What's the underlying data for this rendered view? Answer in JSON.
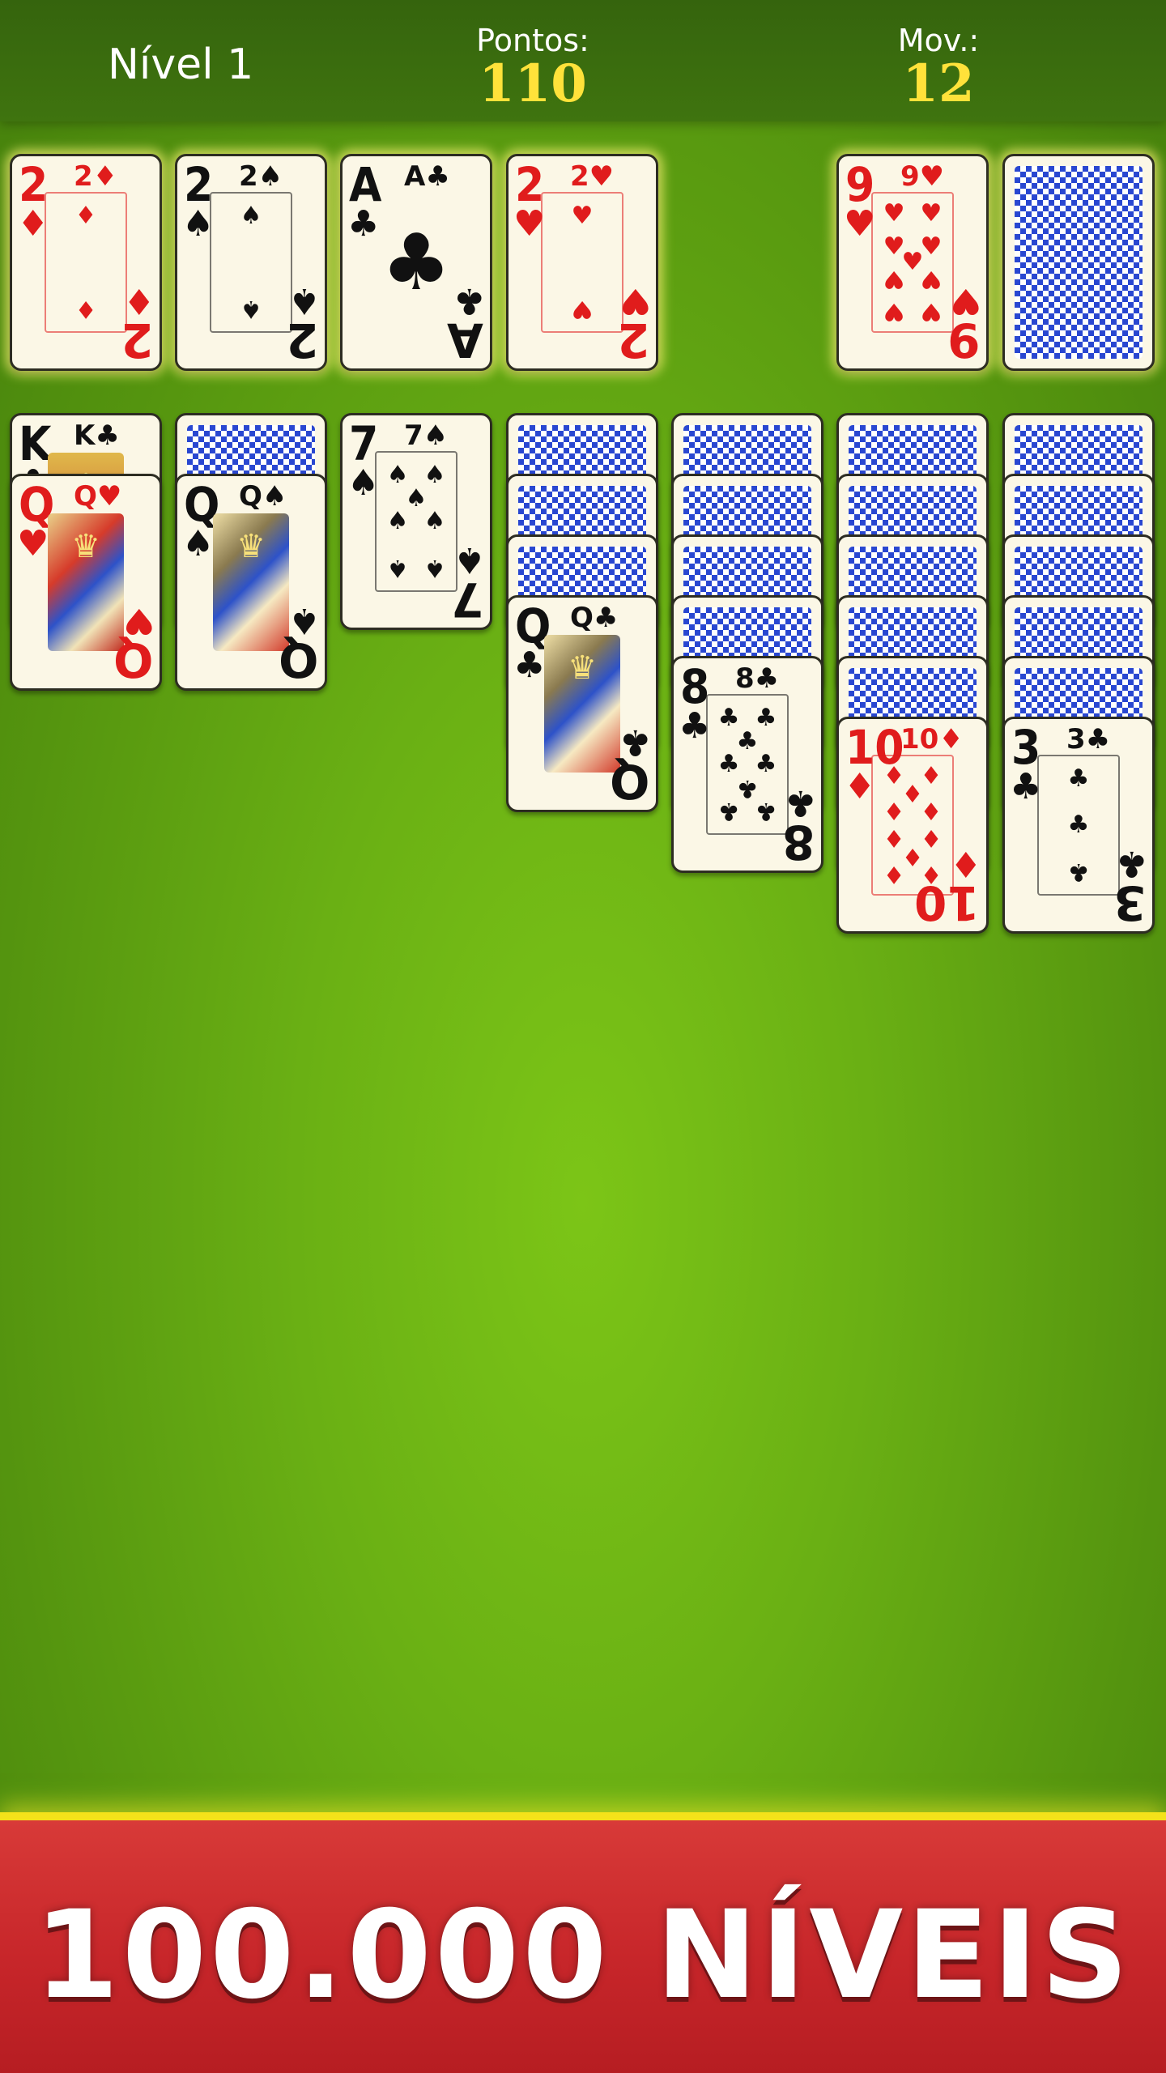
{
  "header": {
    "level": "Nível 1",
    "points_label": "Pontos:",
    "points_value": "110",
    "moves_label": "Mov.:",
    "moves_value": "12"
  },
  "foundations": [
    {
      "rank": "2",
      "suit": "♦",
      "color": "red"
    },
    {
      "rank": "2",
      "suit": "♠",
      "color": "black"
    },
    {
      "rank": "A",
      "suit": "♣",
      "color": "black"
    },
    {
      "rank": "2",
      "suit": "♥",
      "color": "red"
    }
  ],
  "waste": {
    "rank": "9",
    "suit": "♥",
    "color": "red"
  },
  "stock": {
    "face_down": true
  },
  "tableau": [
    {
      "down": 0,
      "up": [
        {
          "rank": "K",
          "suit": "♣",
          "color": "black"
        },
        {
          "rank": "Q",
          "suit": "♥",
          "color": "red"
        }
      ]
    },
    {
      "down": 1,
      "up": [
        {
          "rank": "Q",
          "suit": "♠",
          "color": "black"
        }
      ]
    },
    {
      "down": 0,
      "up": [
        {
          "rank": "7",
          "suit": "♠",
          "color": "black"
        }
      ]
    },
    {
      "down": 3,
      "up": [
        {
          "rank": "Q",
          "suit": "♣",
          "color": "black"
        }
      ]
    },
    {
      "down": 4,
      "up": [
        {
          "rank": "8",
          "suit": "♣",
          "color": "black"
        }
      ]
    },
    {
      "down": 5,
      "up": [
        {
          "rank": "10",
          "suit": "♦",
          "color": "red"
        }
      ]
    },
    {
      "down": 5,
      "up": [
        {
          "rank": "3",
          "suit": "♣",
          "color": "black"
        }
      ]
    }
  ],
  "banner": {
    "text": "100.000 NÍVEIS"
  },
  "colors": {
    "felt": "#6ab014",
    "topbar": "#3a6b0e",
    "banner": "#c7262a",
    "score": "#ffe23a"
  }
}
